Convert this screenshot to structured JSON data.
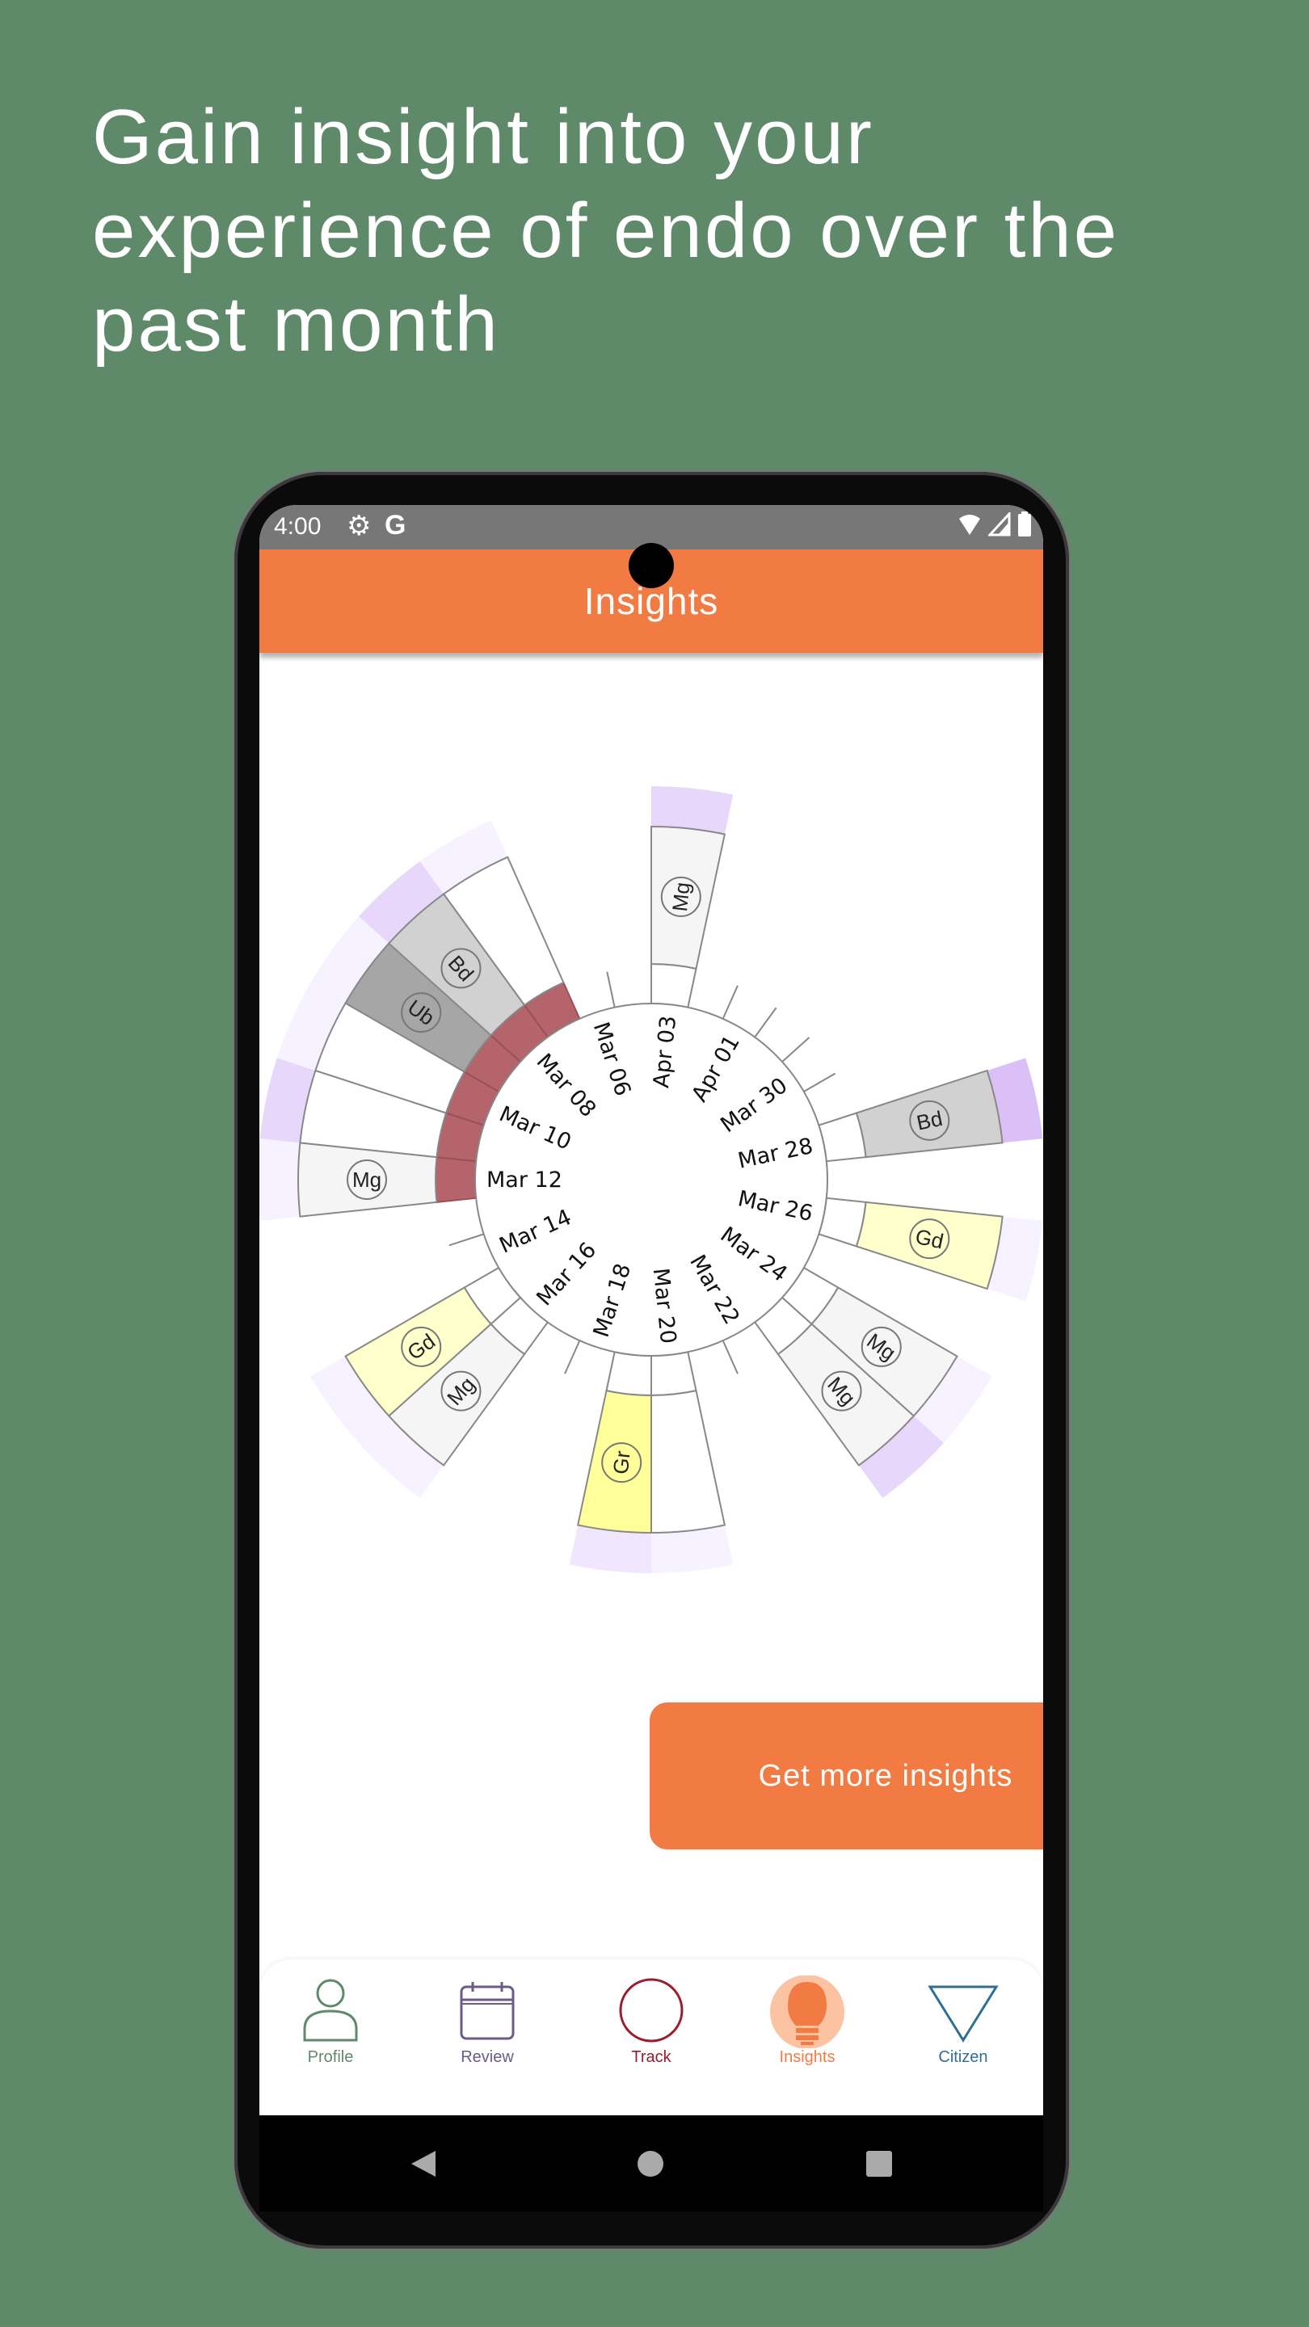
{
  "headline": "Gain insight into your experience of endo over the past month",
  "status_bar": {
    "time": "4:00",
    "icons": [
      "gear-icon",
      "google-g-icon",
      "wifi-icon",
      "signal-icon",
      "battery-icon"
    ],
    "g_letter": "G"
  },
  "app_bar": {
    "title": "Insights",
    "color": "#f27b44"
  },
  "cta": {
    "label": "Get more insights"
  },
  "bottom_nav": [
    {
      "label": "Profile",
      "icon": "person-icon",
      "color": "#5f8a6a"
    },
    {
      "label": "Review",
      "icon": "calendar-icon",
      "color": "#6b5b86"
    },
    {
      "label": "Track",
      "icon": "circle-icon",
      "color": "#9b1c2e"
    },
    {
      "label": "Insights",
      "icon": "lightbulb-icon",
      "color": "#f27b44",
      "active": true
    },
    {
      "label": "Citizen",
      "icon": "triangle-icon",
      "color": "#2f6f94"
    }
  ],
  "colors": {
    "period": "#b5646b",
    "symptoms": {
      "Mg": "#f5f5f5",
      "Bd": "#d1d1d1",
      "Ub": "#a6a6a6",
      "Gd": "#ffffcc",
      "Gr": "#ffff99"
    },
    "band_levels": [
      "#ffffff",
      "#f7f2ff",
      "#f0e7ff",
      "#e6d7fb",
      "#dbc0f8"
    ]
  },
  "chart_data": {
    "type": "radial",
    "direction": "clockwise, newest date at top",
    "date_labels": [
      "Apr 03",
      "Apr 01",
      "Mar 30",
      "Mar 28",
      "Mar 26",
      "Mar 24",
      "Mar 22",
      "Mar 20",
      "Mar 18",
      "Mar 16",
      "Mar 14",
      "Mar 12",
      "Mar 10",
      "Mar 08",
      "Mar 06"
    ],
    "days": [
      {
        "date": "Apr 03",
        "period": false,
        "symptom": "Mg",
        "band": 3
      },
      {
        "date": "Apr 02"
      },
      {
        "date": "Apr 01"
      },
      {
        "date": "Mar 31"
      },
      {
        "date": "Mar 30"
      },
      {
        "date": "Mar 29"
      },
      {
        "date": "Mar 28",
        "period": false,
        "symptom": "Bd",
        "band": 4
      },
      {
        "date": "Mar 27"
      },
      {
        "date": "Mar 26",
        "period": false,
        "symptom": "Gd",
        "band": 1
      },
      {
        "date": "Mar 25"
      },
      {
        "date": "Mar 24",
        "period": false,
        "symptom": "Mg",
        "band": 1
      },
      {
        "date": "Mar 23",
        "period": false,
        "symptom": "Mg",
        "band": 3
      },
      {
        "date": "Mar 22"
      },
      {
        "date": "Mar 21"
      },
      {
        "date": "Mar 20",
        "period": false,
        "symptom": "",
        "band": 1
      },
      {
        "date": "Mar 19",
        "period": false,
        "symptom": "Gr",
        "band": 2
      },
      {
        "date": "Mar 18"
      },
      {
        "date": "Mar 17"
      },
      {
        "date": "Mar 16",
        "period": false,
        "symptom": "Mg",
        "band": 1
      },
      {
        "date": "Mar 15",
        "period": false,
        "symptom": "Gd",
        "band": 1
      },
      {
        "date": "Mar 14"
      },
      {
        "date": "Mar 13"
      },
      {
        "date": "Mar 12",
        "period": true,
        "symptom": "Mg",
        "band": 1
      },
      {
        "date": "Mar 11",
        "period": true,
        "symptom": "",
        "band": 3
      },
      {
        "date": "Mar 10",
        "period": true,
        "symptom": "",
        "band": 1
      },
      {
        "date": "Mar 09",
        "period": true,
        "symptom": "Ub",
        "band": 1
      },
      {
        "date": "Mar 08",
        "period": true,
        "symptom": "Bd",
        "band": 3
      },
      {
        "date": "Mar 07",
        "period": true,
        "symptom": "",
        "band": 1
      },
      {
        "date": "Mar 06"
      },
      {
        "date": "Mar 05"
      }
    ]
  }
}
